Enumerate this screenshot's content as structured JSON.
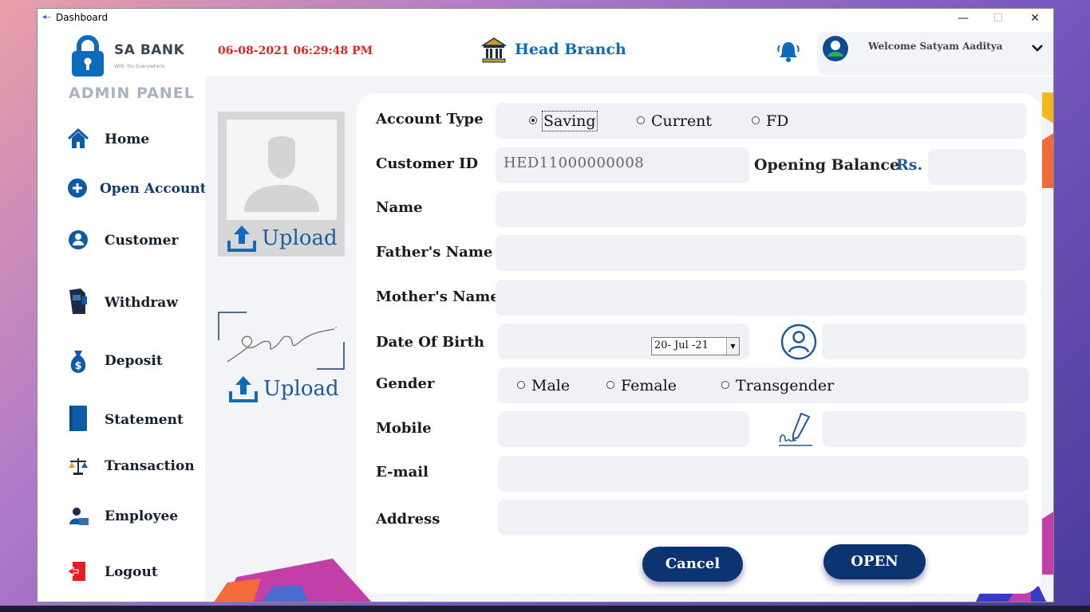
{
  "window": {
    "title": "Dashboard",
    "minimize": "—",
    "maximize": "☐",
    "close": "✕"
  },
  "brand": {
    "name": "SA BANK",
    "tagline": "With You Everywhere",
    "panel": "ADMIN PANEL"
  },
  "nav": [
    {
      "label": "Home",
      "icon": "home-icon"
    },
    {
      "label": "Open Account",
      "icon": "plus-circle-icon"
    },
    {
      "label": "Customer",
      "icon": "customer-icon"
    },
    {
      "label": "Withdraw",
      "icon": "atm-icon"
    },
    {
      "label": "Deposit",
      "icon": "money-bag-icon"
    },
    {
      "label": "Statement",
      "icon": "notebook-icon"
    },
    {
      "label": "Transaction",
      "icon": "scale-icon"
    },
    {
      "label": "Employee",
      "icon": "employee-icon"
    },
    {
      "label": "Logout",
      "icon": "logout-icon"
    }
  ],
  "header": {
    "datetime": "06-08-2021 06:29:48 PM",
    "branch": "Head Branch",
    "welcome": "Welcome Satyam Aaditya"
  },
  "upload": {
    "photo_label": "Upload",
    "signature_label": "Upload"
  },
  "form": {
    "account_type_label": "Account Type",
    "account_types": [
      "Saving",
      "Current",
      "FD"
    ],
    "account_type_selected": "Saving",
    "customer_id_label": "Customer ID",
    "customer_id_value": "HED11000000008",
    "opening_balance_label": "Opening Balance",
    "currency": "Rs.",
    "name_label": "Name",
    "father_label": "Father's Name",
    "mother_label": "Mother's Name",
    "dob_label": "Date Of Birth",
    "dob_value": "20- Jul -21",
    "gender_label": "Gender",
    "genders": [
      "Male",
      "Female",
      "Transgender"
    ],
    "mobile_label": "Mobile",
    "email_label": "E-mail",
    "address_label": "Address",
    "cancel_label": "Cancel",
    "open_label": "OPEN"
  },
  "colors": {
    "accent": "#0c3470",
    "brand_blue": "#0d6bbd",
    "datetime_red": "#e32222",
    "field_bg": "#f0f1f6"
  }
}
